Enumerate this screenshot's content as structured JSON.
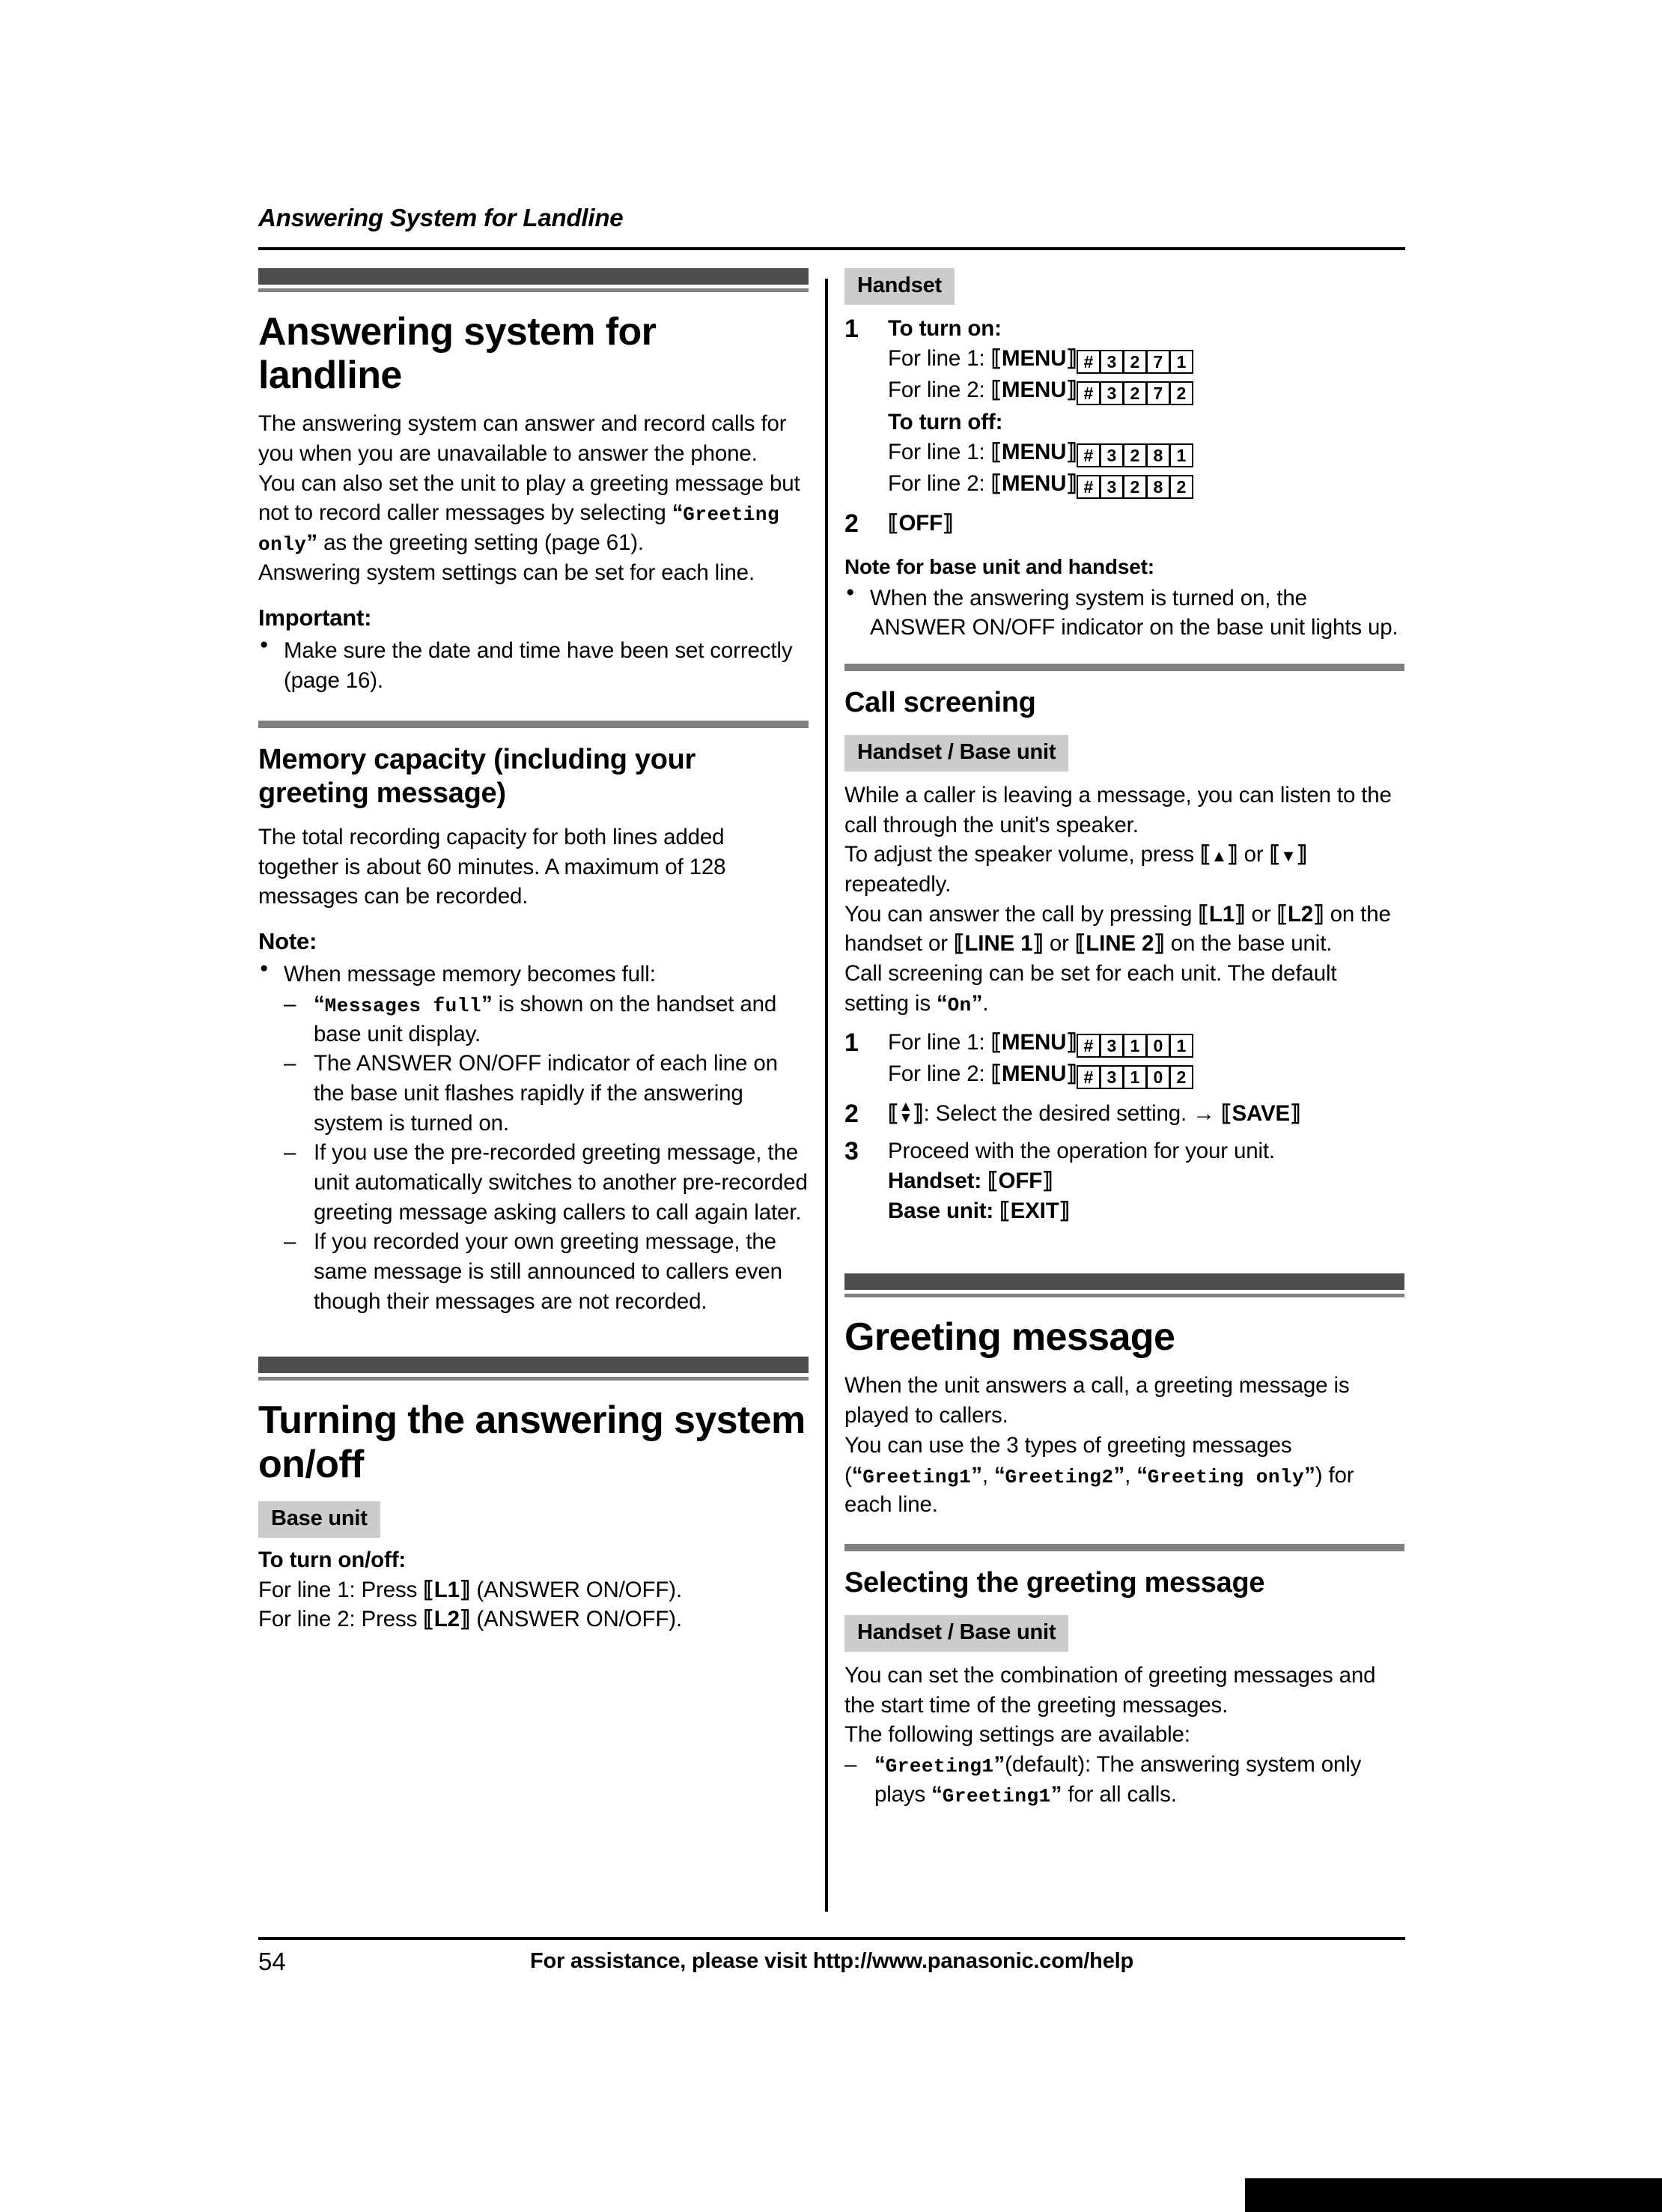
{
  "running_head": "Answering System for Landline",
  "footer": {
    "page_number": "54",
    "assistance_text": "For assistance, please visit http://www.panasonic.com/help"
  },
  "left_column": {
    "chapter_title": "Answering system for landline",
    "intro": {
      "p1": "The answering system can answer and record calls for you when you are unavailable to answer the phone.",
      "p2_before": "You can also set the unit to play a greeting message but not to record caller messages by selecting ",
      "p2_device": "Greeting only",
      "p2_after": " as the greeting setting (page 61).",
      "p3": "Answering system settings can be set for each line."
    },
    "important": {
      "label": "Important:",
      "items": [
        "Make sure the date and time have been set correctly (page 16)."
      ]
    },
    "memory_capacity": {
      "heading": "Memory capacity (including your greeting message)",
      "body": "The total recording capacity for both lines added together is about 60 minutes. A maximum of 128 messages can be recorded.",
      "note_label": "Note:",
      "bullet": "When message memory becomes full:",
      "sub_items": [
        {
          "device": "Messages full",
          "before": "",
          "after": " is shown on the handset and base unit display."
        },
        {
          "device": "",
          "before": "The ANSWER ON/OFF indicator of each line on the base unit flashes rapidly if the answering system is turned on.",
          "after": ""
        },
        {
          "device": "",
          "before": "If you use the pre-recorded greeting message, the unit automatically switches to another pre-recorded greeting message asking callers to call again later.",
          "after": ""
        },
        {
          "device": "",
          "before": "If you recorded your own greeting message, the same message is still announced to callers even though their messages are not recorded.",
          "after": ""
        }
      ]
    },
    "turning_onoff": {
      "chapter_title": "Turning the answering system on/off",
      "badge": "Base unit",
      "sub_heading": "To turn on/off:",
      "line1_prefix": "For line 1: Press ",
      "line1_key": "L1",
      "line1_suffix": " (ANSWER ON/OFF).",
      "line2_prefix": "For line 2: Press ",
      "line2_key": "L2",
      "line2_suffix": " (ANSWER ON/OFF)."
    }
  },
  "right_column": {
    "handset_steps": {
      "badge": "Handset",
      "step1": {
        "num": "1",
        "to_turn_on": "To turn on:",
        "on_line1_label": "For line 1: ",
        "on_line1_menu": "MENU",
        "on_line1_caps": [
          "#",
          "3",
          "2",
          "7",
          "1"
        ],
        "on_line2_label": "For line 2: ",
        "on_line2_menu": "MENU",
        "on_line2_caps": [
          "#",
          "3",
          "2",
          "7",
          "2"
        ],
        "to_turn_off": "To turn off:",
        "off_line1_label": "For line 1: ",
        "off_line1_menu": "MENU",
        "off_line1_caps": [
          "#",
          "3",
          "2",
          "8",
          "1"
        ],
        "off_line2_label": "For line 2: ",
        "off_line2_menu": "MENU",
        "off_line2_caps": [
          "#",
          "3",
          "2",
          "8",
          "2"
        ]
      },
      "step2": {
        "num": "2",
        "key": "OFF"
      },
      "note_label": "Note for base unit and handset:",
      "note_items": [
        "When the answering system is turned on, the ANSWER ON/OFF indicator on the base unit lights up."
      ]
    },
    "call_screening": {
      "heading": "Call screening",
      "badge": "Handset / Base unit",
      "p1": "While a caller is leaving a message, you can listen to the call through the unit's speaker.",
      "p2_before": "To adjust the speaker volume, press ",
      "p2_key_up": "▲",
      "p2_mid": " or ",
      "p2_key_down": "▼",
      "p2_after": " repeatedly.",
      "p3_before": "You can answer the call by pressing ",
      "p3_key_l1": "L1",
      "p3_mid1": " or ",
      "p3_key_l2": "L2",
      "p3_mid2": " on the handset or ",
      "p3_key_line1": "LINE 1",
      "p3_mid3": " or ",
      "p3_key_line2": "LINE 2",
      "p3_after": " on the base unit.",
      "p4_before": "Call screening can be set for each unit. The default setting is ",
      "p4_device": "On",
      "p4_after": ".",
      "steps": {
        "step1": {
          "num": "1",
          "line1_label": "For line 1: ",
          "line1_menu": "MENU",
          "line1_caps": [
            "#",
            "3",
            "1",
            "0",
            "1"
          ],
          "line2_label": "For line 2: ",
          "line2_menu": "MENU",
          "line2_caps": [
            "#",
            "3",
            "1",
            "0",
            "2"
          ]
        },
        "step2": {
          "num": "2",
          "text_mid": ": Select the desired setting. ",
          "arrow": "→",
          "key_save": "SAVE"
        },
        "step3": {
          "num": "3",
          "text": "Proceed with the operation for your unit.",
          "handset_label": "Handset: ",
          "handset_key": "OFF",
          "baseunit_label": "Base unit: ",
          "baseunit_key": "EXIT"
        }
      }
    },
    "greeting_message": {
      "chapter_title": "Greeting message",
      "p1": "When the unit answers a call, a greeting message is played to callers.",
      "p2_before": "You can use the 3 types of greeting messages (",
      "p2_g1": "Greeting1",
      "p2_sep1": ", ",
      "p2_g2": "Greeting2",
      "p2_sep2": ", ",
      "p2_g3": "Greeting only",
      "p2_after": ") for each line.",
      "selecting": {
        "heading": "Selecting the greeting message",
        "badge": "Handset / Base unit",
        "p1": "You can set the combination of greeting messages and the start time of the greeting messages.",
        "p2": "The following settings are available:",
        "item1_device": "Greeting1",
        "item1_mid": "(default): The answering system only plays ",
        "item1_device2": "Greeting1",
        "item1_after": " for all calls."
      }
    }
  }
}
